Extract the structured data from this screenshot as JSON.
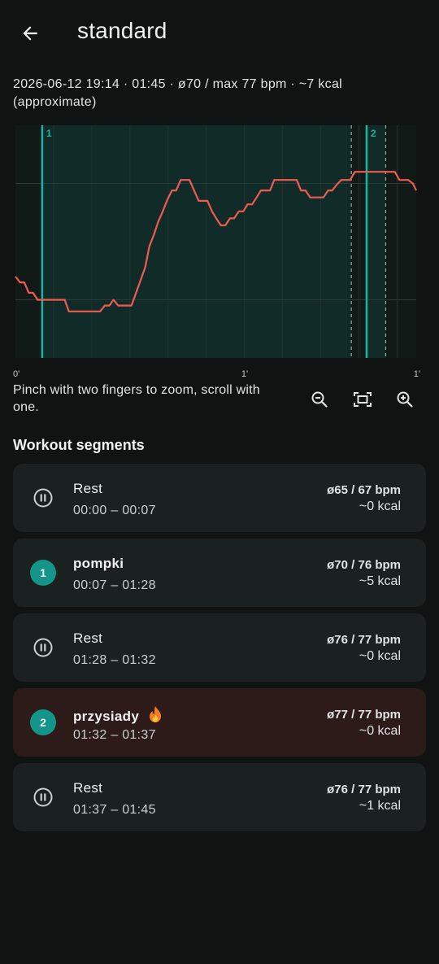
{
  "header": {
    "title": "standard",
    "back_icon": "arrow-left-icon"
  },
  "summary": {
    "line1": "2026-06-12 19:14 · 01:45 · ø70 / max 77 bpm · ~7 kcal",
    "line2": "(approximate)"
  },
  "chart": {
    "x_tick_labels": [
      "0'",
      "1'",
      "1'"
    ],
    "segment_markers": [
      "1",
      "2"
    ]
  },
  "chart_data": {
    "type": "line",
    "title": "",
    "xlabel": "",
    "ylabel": "",
    "x_unit": "seconds",
    "xlim": [
      0,
      105
    ],
    "ylim": [
      60,
      80
    ],
    "series": [
      {
        "x": [
          0,
          1.2,
          2.3,
          3.5,
          4.6,
          5.8,
          7,
          8.2,
          9.4,
          10.5,
          11.7,
          12.9,
          14,
          15.2,
          16.4,
          17.6,
          18.7,
          19.9,
          21.1,
          22.2,
          23.4,
          24.6,
          25.7,
          26.9,
          28,
          29.2,
          30.4,
          31.6,
          32.8,
          34,
          35.1,
          36.3,
          37.4,
          38.6,
          39.8,
          41,
          42.1,
          43.3,
          44.5,
          45.6,
          46.8,
          48,
          49.1,
          50.3,
          51.5,
          52.6,
          53.8,
          55,
          56.2,
          57.3,
          58.5,
          59.7,
          60.8,
          62,
          63.2,
          64.3,
          65.5,
          66.7,
          67.8,
          69,
          70.2,
          71.3,
          72.5,
          73.7,
          74.8,
          76,
          77.2,
          78.3,
          79.5,
          80.7,
          81.9,
          83,
          84.2,
          85.4,
          86.5,
          87.7,
          88.9,
          90,
          91.2,
          92.4,
          93.6,
          94.7,
          95.9,
          97.1,
          98.2,
          99.4,
          100.6,
          101.7,
          102.9,
          104.1,
          105
        ],
        "y": [
          67,
          66.5,
          66.5,
          65.6,
          65.6,
          65,
          65,
          65,
          65,
          65,
          65,
          65,
          64,
          64,
          64,
          64,
          64,
          64,
          64,
          64,
          64.5,
          64.5,
          65,
          64.5,
          64.5,
          64.5,
          64.5,
          65.6,
          66.7,
          67.8,
          69.6,
          70.6,
          71.7,
          72.6,
          73.6,
          74.4,
          74.4,
          75.3,
          75.3,
          75.3,
          74.4,
          73.5,
          73.5,
          73.5,
          72.6,
          72,
          71.4,
          71.4,
          72,
          72,
          72.6,
          72.6,
          73.2,
          73.2,
          73.8,
          74.4,
          74.4,
          74.4,
          75.3,
          75.3,
          75.3,
          75.3,
          75.3,
          75.3,
          74.4,
          74.4,
          73.8,
          73.8,
          73.8,
          73.8,
          74.4,
          74.4,
          74.9,
          75.3,
          75.3,
          75.3,
          76,
          76,
          76,
          76,
          76,
          76,
          76,
          76,
          76,
          76,
          75.3,
          75.3,
          75.3,
          75,
          74.4
        ]
      }
    ],
    "segments": [
      {
        "label": "1",
        "start_s": 7,
        "end_s": 88
      },
      {
        "label": "2",
        "start_s": 92,
        "end_s": 97
      }
    ],
    "grid": true,
    "line_color": "#ef5b50",
    "segment_line_color": "#1bb3a2"
  },
  "hint": {
    "text": "Pinch with two fingers to zoom, scroll with one."
  },
  "zoom_controls": {
    "zoom_out_icon": "zoom-out-icon",
    "fit_icon": "fit-screen-icon",
    "zoom_in_icon": "zoom-in-icon"
  },
  "segments_section": {
    "title": "Workout segments",
    "items": [
      {
        "type": "rest",
        "name": "Rest",
        "time": "00:00 – 00:07",
        "bpm": "ø65 / 67 bpm",
        "kcal": "~0 kcal",
        "icon": "pause-icon"
      },
      {
        "type": "exercise",
        "number": "1",
        "name": "pompki",
        "time": "00:07 – 01:28",
        "bpm": "ø70 / 76 bpm",
        "kcal": "~5 kcal"
      },
      {
        "type": "rest",
        "name": "Rest",
        "time": "01:28 – 01:32",
        "bpm": "ø76 / 77 bpm",
        "kcal": "~0 kcal",
        "icon": "pause-icon"
      },
      {
        "type": "exercise",
        "number": "2",
        "name": "przysiady",
        "time": "01:32 – 01:37",
        "bpm": "ø77 / 77 bpm",
        "kcal": "~0 kcal",
        "highlight": true,
        "icon": "flame-icon"
      },
      {
        "type": "rest",
        "name": "Rest",
        "time": "01:37 – 01:45",
        "bpm": "ø76 / 77 bpm",
        "kcal": "~1 kcal",
        "icon": "pause-icon"
      }
    ]
  },
  "colors": {
    "background": "#0f1413",
    "card": "#1b2120",
    "card_active": "#2c1b19",
    "accent": "#159589",
    "heart_line": "#ef5b50"
  }
}
